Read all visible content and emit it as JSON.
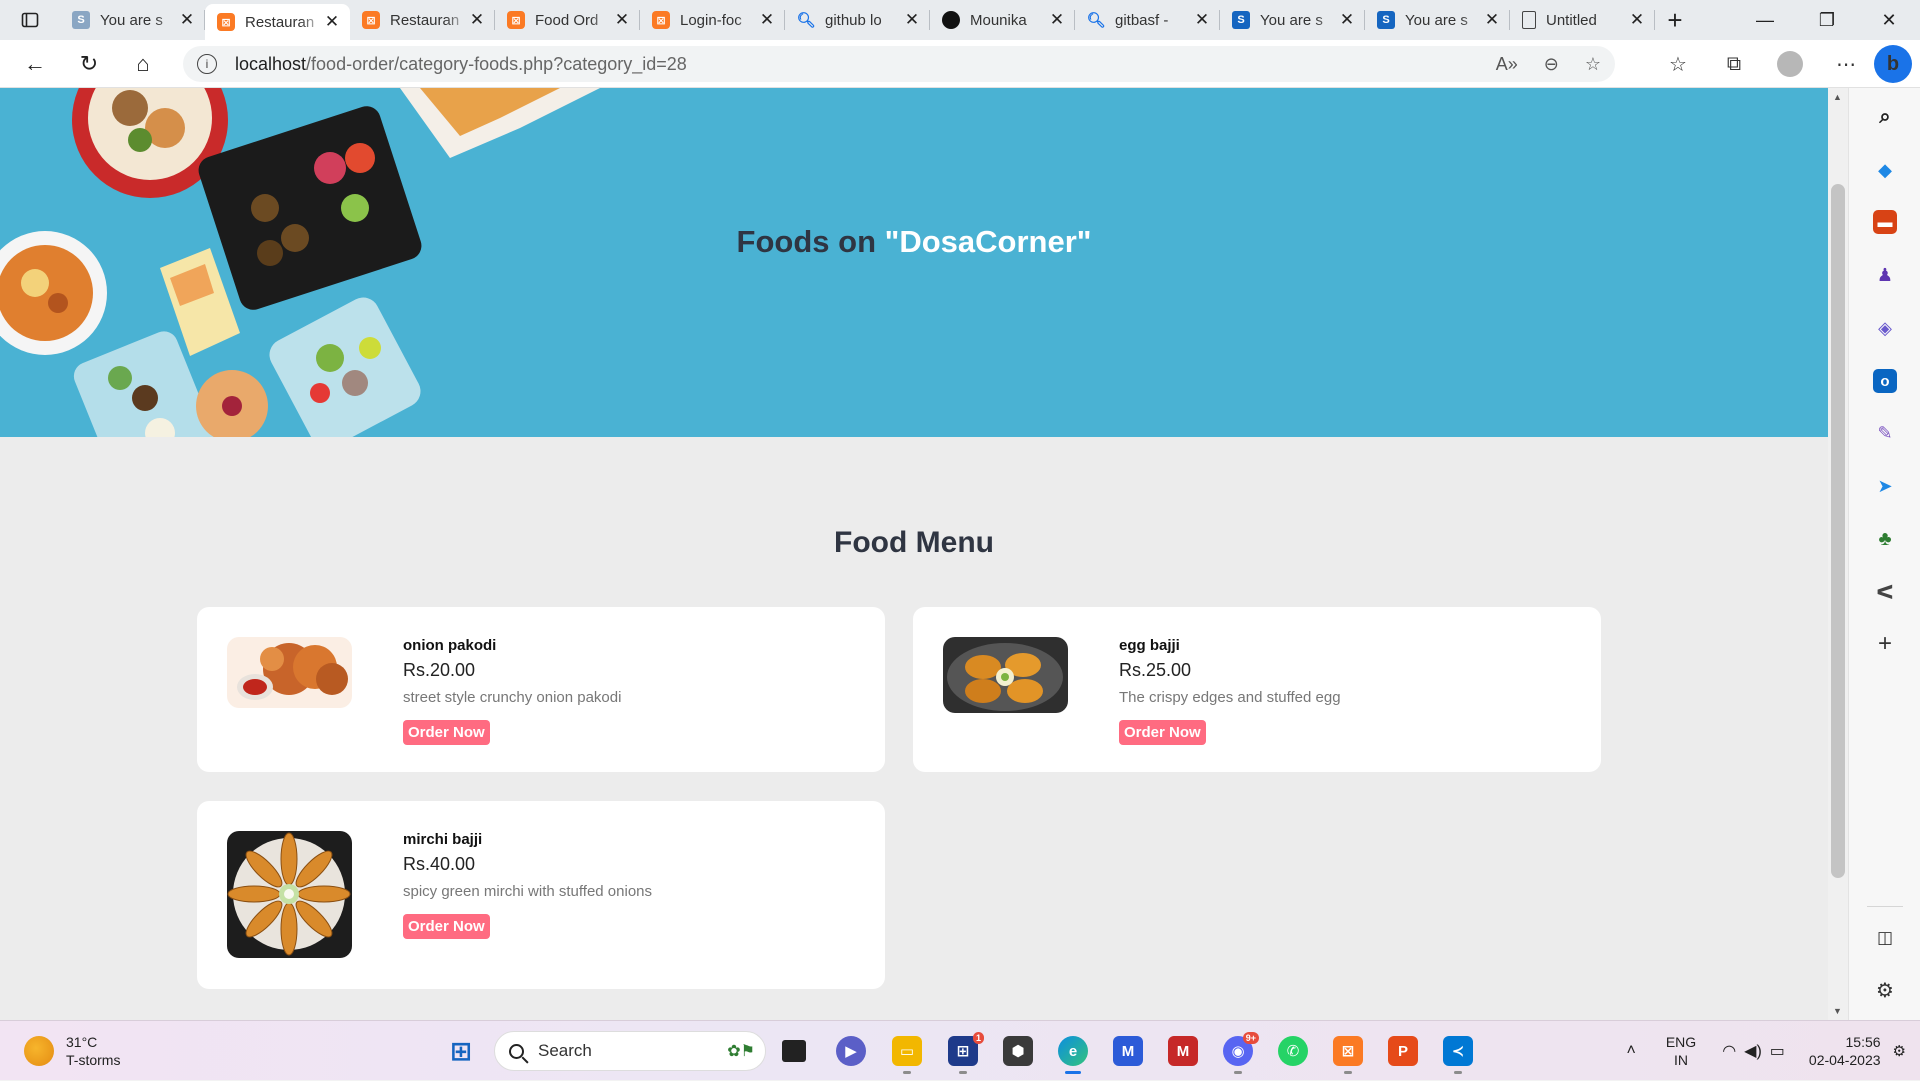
{
  "browser": {
    "tabs": [
      {
        "title": "You are s",
        "favicon": "s-icon"
      },
      {
        "title": "Restauran",
        "favicon": "xampp-icon",
        "active": true
      },
      {
        "title": "Restauran",
        "favicon": "xampp-icon"
      },
      {
        "title": "Food Ord",
        "favicon": "xampp-icon"
      },
      {
        "title": "Login-foc",
        "favicon": "xampp-icon"
      },
      {
        "title": "github lo",
        "favicon": "search-icon"
      },
      {
        "title": "Mounika",
        "favicon": "github-icon"
      },
      {
        "title": "gitbasf -",
        "favicon": "search-icon"
      },
      {
        "title": "You are s",
        "favicon": "s-icon"
      },
      {
        "title": "You are s",
        "favicon": "s-icon"
      },
      {
        "title": "Untitled",
        "favicon": "document-icon"
      }
    ],
    "url_host": "localhost",
    "url_path": "/food-order/category-foods.php?category_id=28"
  },
  "page": {
    "hero_prefix": "Foods on",
    "hero_category": "\"DosaCorner\"",
    "menu_title": "Food Menu",
    "order_label": "Order Now",
    "foods": [
      {
        "name": "onion pakodi",
        "price": "Rs.20.00",
        "description": "street style crunchy onion pakodi"
      },
      {
        "name": "egg bajji",
        "price": "Rs.25.00",
        "description": "The crispy edges and stuffed egg"
      },
      {
        "name": "mirchi bajji",
        "price": "Rs.40.00",
        "description": "spicy green mirchi with stuffed onions"
      }
    ]
  },
  "taskbar": {
    "temperature": "31°C",
    "weather": "T-storms",
    "search_placeholder": "Search",
    "language_line1": "ENG",
    "language_line2": "IN",
    "time": "15:56",
    "date": "02-04-2023",
    "store_badge": "1",
    "discord_badge": "9+"
  },
  "colors": {
    "hero_bg": "#4ab2d3",
    "accent_button": "#ff6b81",
    "heading_text": "#2f3542"
  }
}
